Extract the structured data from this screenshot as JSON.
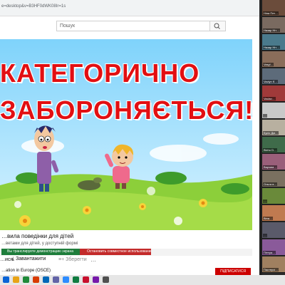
{
  "browser": {
    "url_fragment": "e=desktop&v=B3HF0dWK08Ir=1s"
  },
  "search": {
    "placeholder": "Пошук"
  },
  "video": {
    "heading_line1": "КАТЕГОРИЧНО",
    "heading_line2": "ЗАБОРОНЯЄТЬСЯ!!!"
  },
  "video_info": {
    "title": "…вила поведінки для дітей",
    "description": "…ветами для дітей, у доступній формі",
    "screen_share_notice": "Вы транслируете демонстрацию экрана",
    "stop_share_label": "Остановить совместное использование",
    "like_label": "…ися",
    "download_label": "Завантажити",
    "save_label": "Зберегти",
    "more_label": "…",
    "channel_name": "…ation in Europe (OSCE)",
    "subscribe_label": "ПІДПИСАТИСЯ"
  },
  "participants": [
    {
      "name": "Ніна Пет…",
      "color": "#6b4c3b"
    },
    {
      "name": "Назар Ніт…",
      "color": "#7a6a60"
    },
    {
      "name": "Назар Ніт…",
      "color": "#4a7a8c"
    },
    {
      "name": "Vasyl…",
      "color": "#8a6d5a"
    },
    {
      "name": "Vaclyn б…",
      "color": "#5d6b7a"
    },
    {
      "name": "Vaclav…",
      "color": "#a03a3a"
    },
    {
      "name": "…",
      "color": "#c9c9c9"
    },
    {
      "name": "Кусіо Дм…",
      "color": "#b8b0a0"
    },
    {
      "name": "Bicho D…",
      "color": "#3f6b4a"
    },
    {
      "name": "Варчим…",
      "color": "#9a5f7a"
    },
    {
      "name": "Ольга в…",
      "color": "#7a7060"
    },
    {
      "name": "…",
      "color": "#6a8a3a"
    },
    {
      "name": "Віна…",
      "color": "#c07a50"
    },
    {
      "name": "…",
      "color": "#5a5a6a"
    },
    {
      "name": "Пітера…",
      "color": "#8a5a9a"
    },
    {
      "name": "Пастерсі…",
      "color": "#a08060"
    }
  ],
  "taskbar_icons": [
    "#0a64d6",
    "#e8a317",
    "#1f8a3a",
    "#d83b01",
    "#0067b8",
    "#6264a7",
    "#2d8cff",
    "#107c41",
    "#c8102e",
    "#7719aa",
    "#505050"
  ]
}
